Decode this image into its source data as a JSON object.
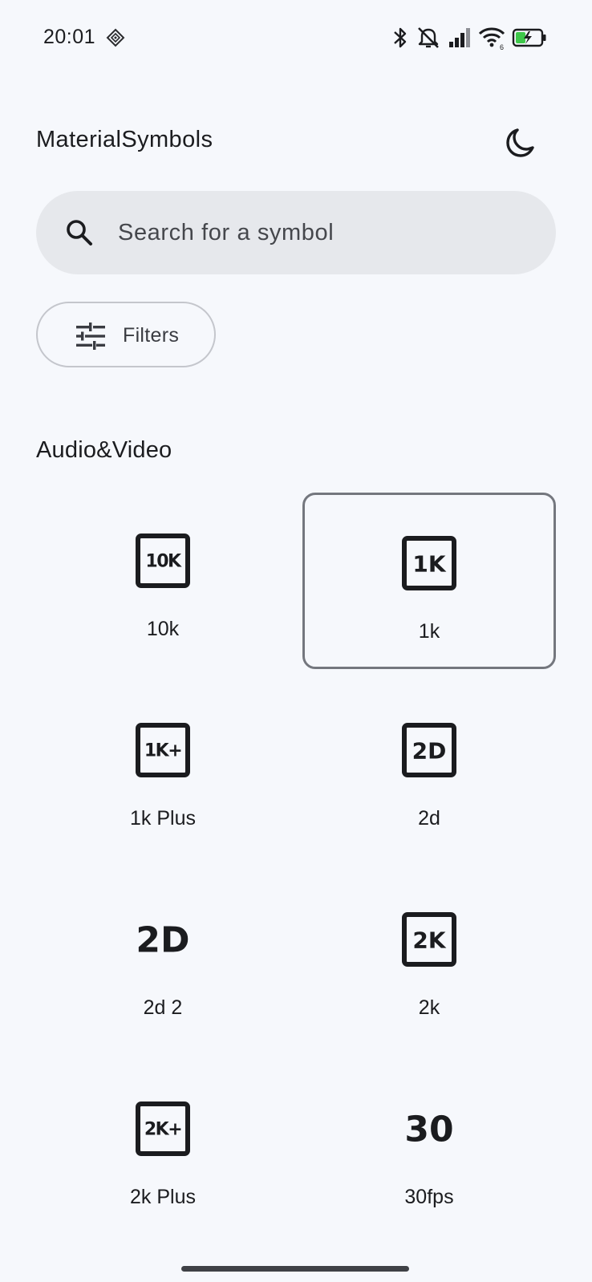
{
  "status_bar": {
    "time": "20:01",
    "icons": [
      "gemini-diamond-icon",
      "bluetooth-icon",
      "mute-icon",
      "signal-icon",
      "wifi-icon",
      "battery-charging-icon"
    ]
  },
  "header": {
    "title": "MaterialSymbols",
    "theme_icon": "dark-mode-moon-icon"
  },
  "search": {
    "placeholder": "Search for a symbol",
    "value": "",
    "icon": "search-icon"
  },
  "filters": {
    "label": "Filters",
    "icon": "tune-icon"
  },
  "section": {
    "title": "Audio&Video"
  },
  "symbols": [
    {
      "label": "10k",
      "icon_text": "10K",
      "boxed": true,
      "selected": false
    },
    {
      "label": "1k",
      "icon_text": "1K",
      "boxed": true,
      "selected": true
    },
    {
      "label": "1k Plus",
      "icon_text": "1K+",
      "boxed": true,
      "selected": false
    },
    {
      "label": "2d",
      "icon_text": "2D",
      "boxed": true,
      "selected": false
    },
    {
      "label": "2d 2",
      "icon_text": "2D",
      "boxed": false,
      "selected": false
    },
    {
      "label": "2k",
      "icon_text": "2K",
      "boxed": true,
      "selected": false
    },
    {
      "label": "2k Plus",
      "icon_text": "2K+",
      "boxed": true,
      "selected": false
    },
    {
      "label": "30fps",
      "icon_text": "30",
      "boxed": false,
      "selected": false
    }
  ],
  "colors": {
    "background": "#f6f8fc",
    "search_bg": "#e6e8ec",
    "icon": "#1b1c1f",
    "selected_border": "#74777e",
    "battery_charge": "#3ec84a"
  }
}
